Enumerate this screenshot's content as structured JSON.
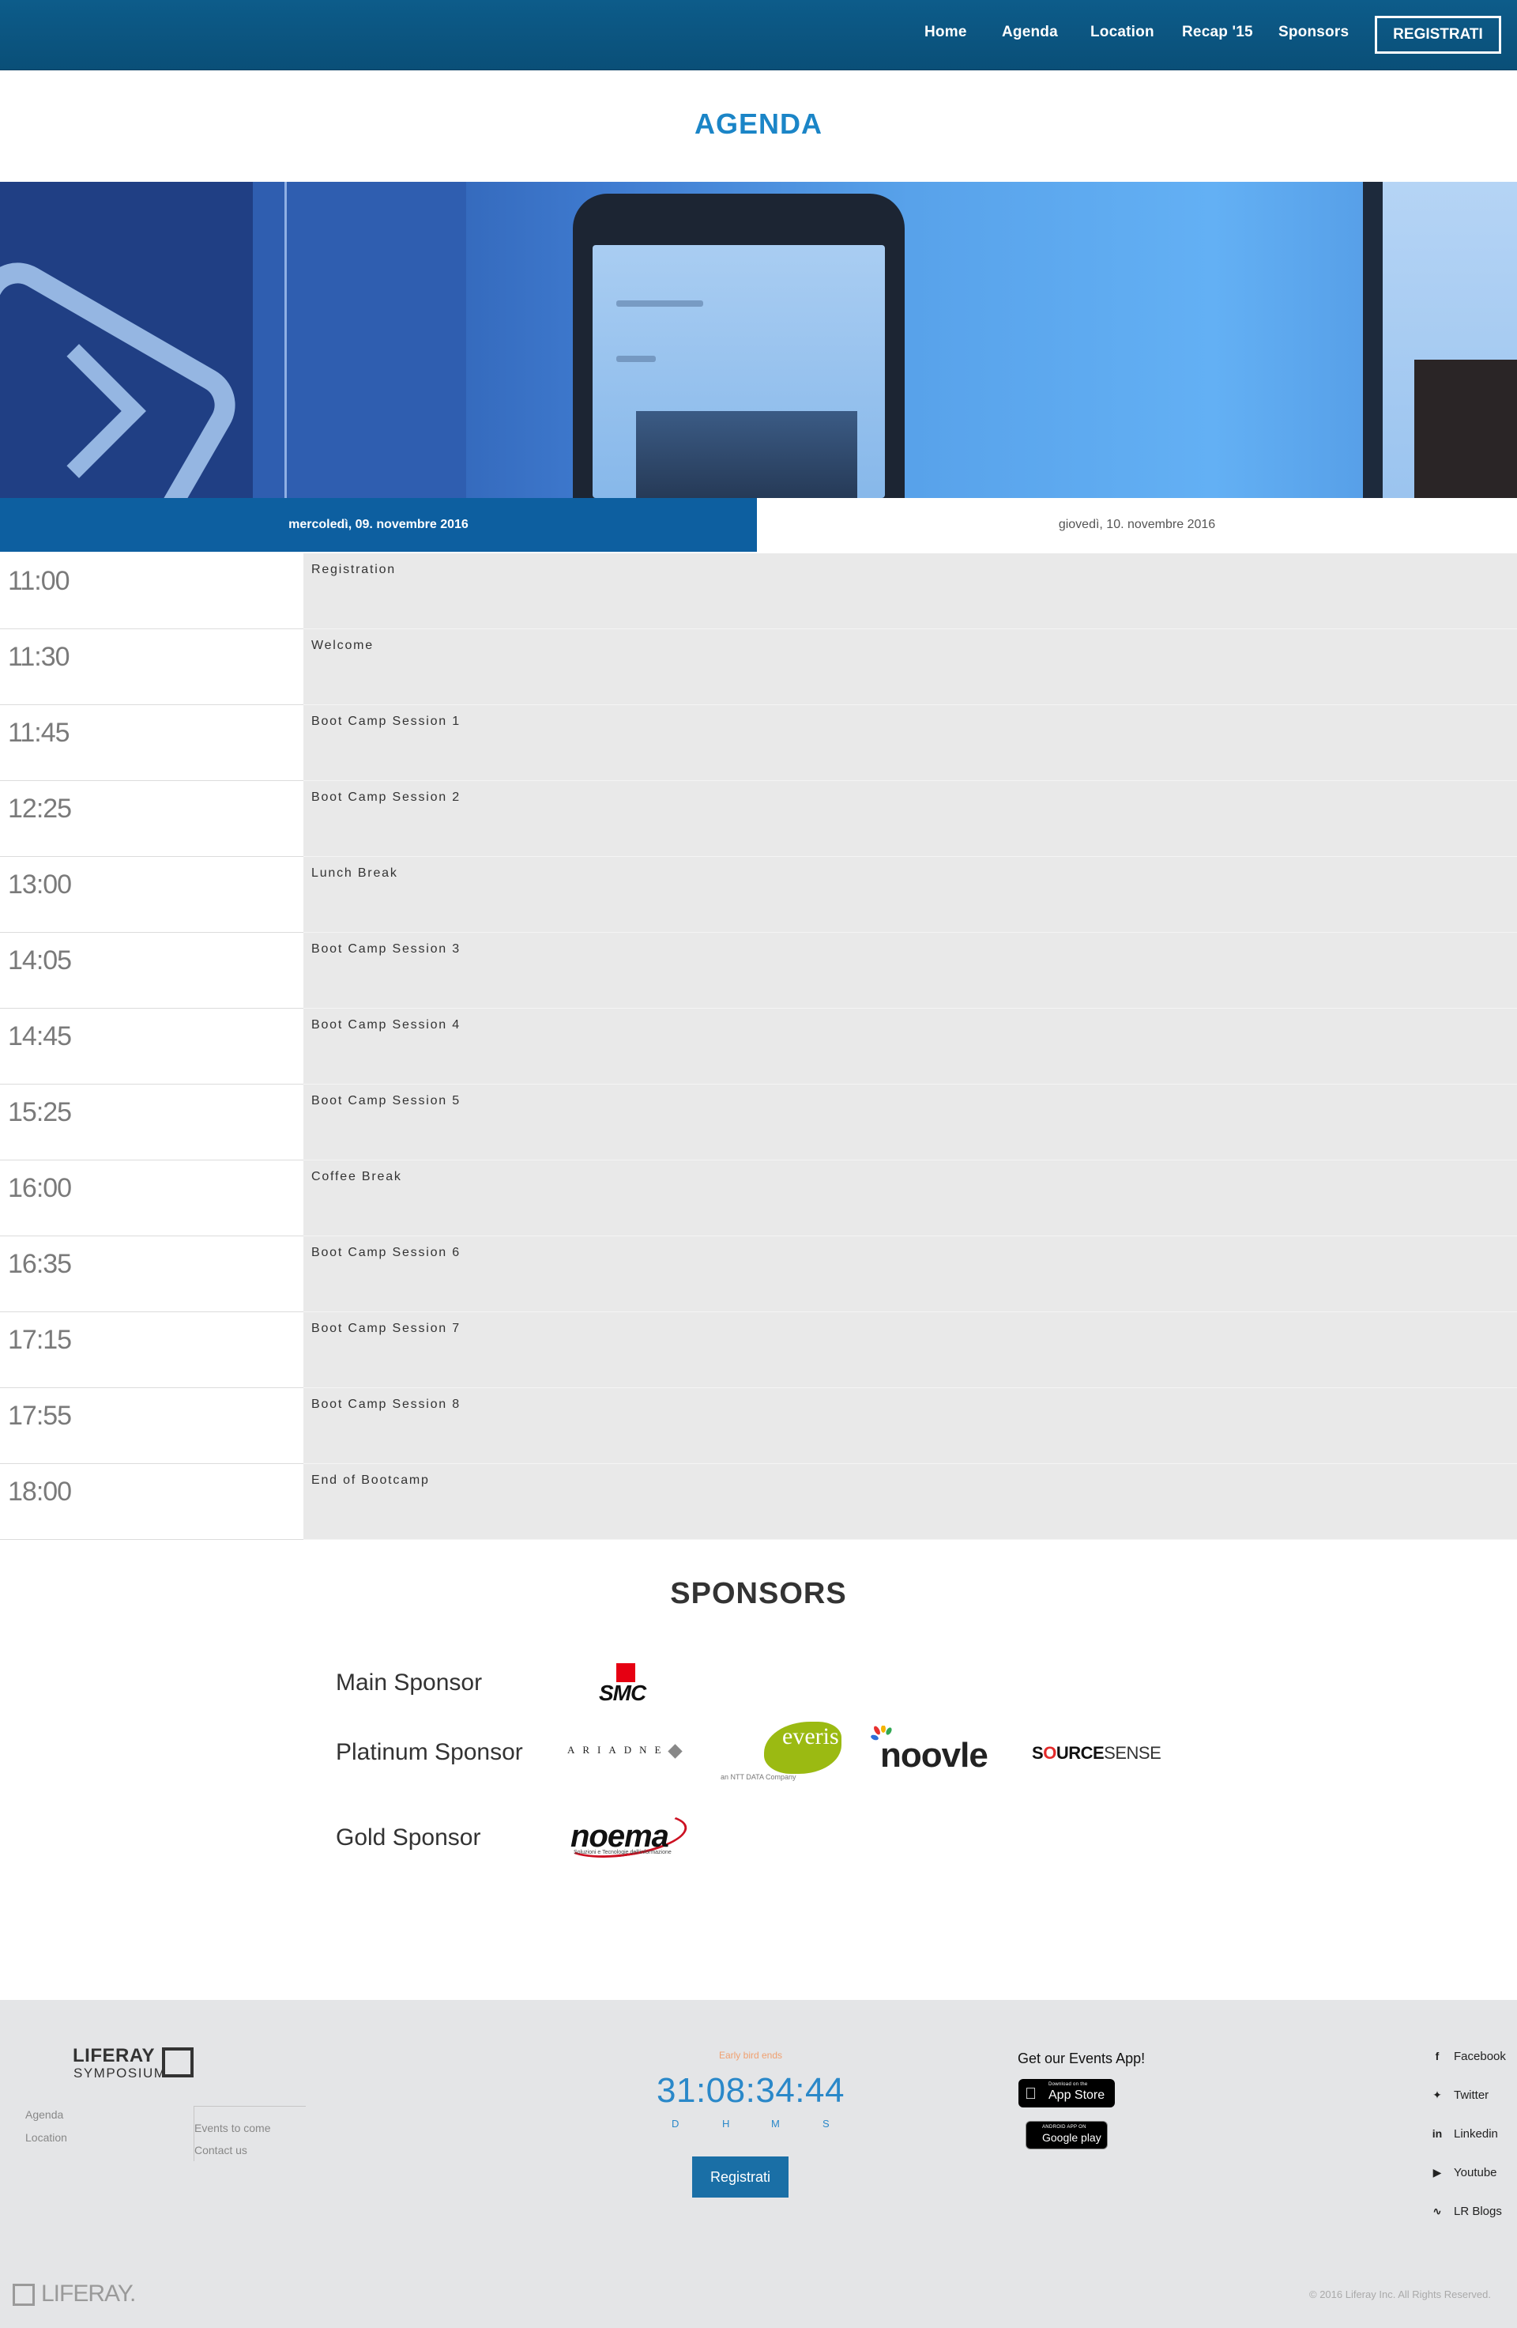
{
  "nav": {
    "items": [
      "Home",
      "Agenda",
      "Location",
      "Recap '15",
      "Sponsors"
    ],
    "register": "REGISTRATI"
  },
  "page_title": "AGENDA",
  "days": [
    {
      "label": "mercoledì, 09. novembre 2016",
      "active": true
    },
    {
      "label": "giovedì, 10. novembre 2016",
      "active": false
    }
  ],
  "schedule": [
    {
      "time": "11:00",
      "title": "Registration"
    },
    {
      "time": "11:30",
      "title": "Welcome"
    },
    {
      "time": "11:45",
      "title": "Boot Camp Session 1"
    },
    {
      "time": "12:25",
      "title": "Boot Camp Session 2"
    },
    {
      "time": "13:00",
      "title": "Lunch Break"
    },
    {
      "time": "14:05",
      "title": "Boot Camp Session 3"
    },
    {
      "time": "14:45",
      "title": "Boot Camp Session 4"
    },
    {
      "time": "15:25",
      "title": "Boot Camp Session 5"
    },
    {
      "time": "16:00",
      "title": "Coffee Break"
    },
    {
      "time": "16:35",
      "title": "Boot Camp Session 6"
    },
    {
      "time": "17:15",
      "title": "Boot Camp Session 7"
    },
    {
      "time": "17:55",
      "title": "Boot Camp Session 8"
    },
    {
      "time": "18:00",
      "title": "End of Bootcamp"
    }
  ],
  "sponsors": {
    "title": "SPONSORS",
    "main_label": "Main Sponsor",
    "platinum_label": "Platinum Sponsor",
    "gold_label": "Gold Sponsor",
    "logos": {
      "smc": "SMC",
      "ariadne": "ARIADNE",
      "everis": "everis",
      "everis_sub": "an NTT DATA Company",
      "noovle": "noovle",
      "sourcesense_bold": "S",
      "sourcesense_o": "O",
      "sourcesense_rest1": "URCE",
      "sourcesense_rest2": "SENSE",
      "noema": "noema",
      "noema_sub": "Soluzioni e Tecnologie dell'informazione"
    }
  },
  "footer": {
    "logo_text": "LIFERAY",
    "logo_sub": "SYMPOSIUM",
    "links_col1": [
      "Agenda",
      "Location"
    ],
    "links_col2": [
      "Events to come",
      "Contact us"
    ],
    "early_bird": "Early bird ends",
    "countdown": "31:08:34:44",
    "units": [
      "D",
      "H",
      "M",
      "S"
    ],
    "register": "Registrati",
    "app_title": "Get our Events App!",
    "app_store_small": "Download on the",
    "app_store_big": "App Store",
    "google_small": "ANDROID APP ON",
    "google_big": "Google play",
    "social": [
      "Facebook",
      "Twitter",
      "Linkedin",
      "Youtube",
      "LR Blogs"
    ],
    "bottom_logo": "LIFERAY.",
    "copyright": "© 2016 Liferay Inc. All Rights Reserved."
  },
  "colors": {
    "nav_bg": "#0a4f78",
    "accent": "#1b85c7",
    "active_tab": "#0d5fa0",
    "session_bg": "#e9e9e9",
    "footer_bg": "#e4e5e7"
  }
}
